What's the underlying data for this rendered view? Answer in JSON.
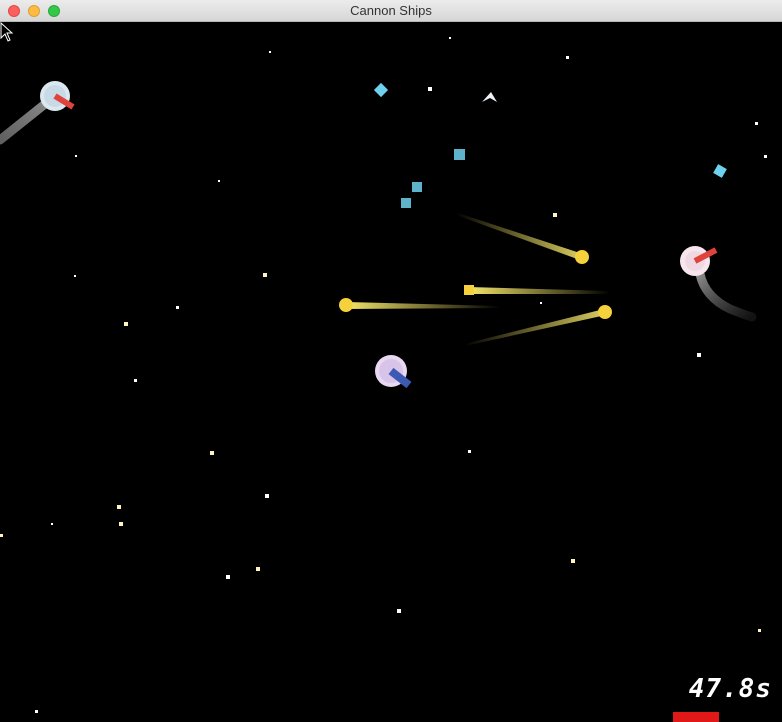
{
  "window": {
    "title": "Cannon Ships"
  },
  "hud": {
    "timer": "47.8s",
    "health_fraction": 1.0
  },
  "colors": {
    "background": "#000000",
    "player_ship": "#e8d8f2",
    "player_cannon": "#3c5ab4",
    "enemy_ship": "#dce8f0",
    "enemy_ship_pink": "#f8e6ee",
    "enemy_cannon": "#e0423c",
    "projectile": "#f5d23c",
    "crystal": "#6ed2ee",
    "health": "#e01818"
  },
  "icons": {
    "cursor": "arrow-cursor-icon",
    "close": "close-window-icon",
    "minimize": "minimize-window-icon",
    "maximize": "maximize-window-icon"
  }
}
